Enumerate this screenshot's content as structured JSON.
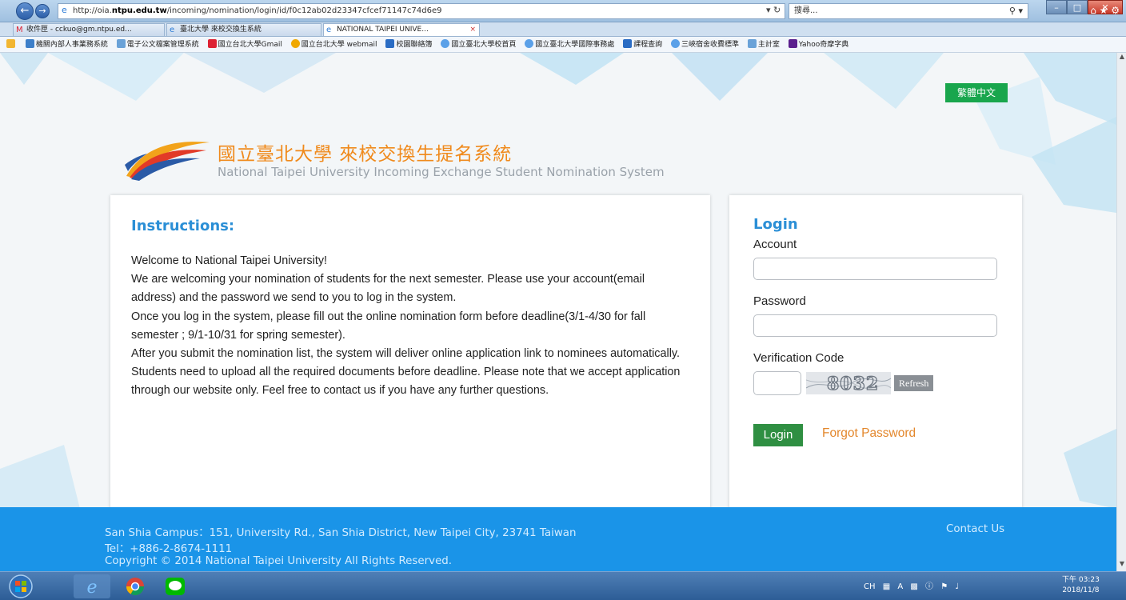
{
  "browser": {
    "address_prefix": "http://oia.",
    "address_host": "ntpu.edu.tw",
    "address_path": "/incoming/nomination/login/id/f0c12ab02d23347cfcef71147c74d6e9",
    "search_placeholder": "搜尋...",
    "tabs": [
      {
        "label": "收件匣 - cckuo@gm.ntpu.ed..."
      },
      {
        "label": "臺北大學 來校交換生系統"
      },
      {
        "label": "NATIONAL TAIPEI UNIVE...",
        "active": true
      }
    ],
    "favorites": [
      "機關內部人事業務系統",
      "電子公文檔案管理系統",
      "國立台北大學Gmail",
      "國立台北大學 webmail",
      "校園聯絡簿",
      "國立臺北大學校首頁",
      "國立臺北大學國際事務處",
      "課程查詢",
      "三峽宿舍收費標準",
      "主計室",
      "Yahoo奇摩字典"
    ]
  },
  "page": {
    "language_button": "繁體中文",
    "title_zh": "國立臺北大學 來校交換生提名系統",
    "title_en": "National Taipei University Incoming Exchange Student Nomination System",
    "instructions": {
      "heading": "Instructions:",
      "paragraphs": [
        "Welcome to National Taipei University!",
        "We are welcoming your nomination of students for the next semester. Please use your account(email address) and the password we send to you to log in the system.",
        "Once you log in the system, please fill out the online nomination form before deadline(3/1-4/30 for fall semester ; 9/1-10/31 for spring semester).",
        "After you submit the nomination list, the system will deliver online application link to nominees automatically. Students need to upload all the required documents before deadline. Please note that we accept application through our website only. Feel free to contact us if you have any further questions."
      ]
    },
    "login": {
      "heading": "Login",
      "account_label": "Account",
      "password_label": "Password",
      "verification_label": "Verification Code",
      "captcha_text": "8032",
      "refresh_label": "Refresh",
      "login_button": "Login",
      "forgot_link": "Forgot Password"
    },
    "footer": {
      "address": "San Shia Campus：151, University Rd., San Shia District, New Taipei City, 23741 Taiwan",
      "tel": "Tel：+886-2-8674-1111",
      "copyright": "Copyright © 2014 National Taipei University All Rights Reserved.",
      "contact": "Contact Us"
    }
  },
  "taskbar": {
    "tray_lang": "CH",
    "clock_ampm": "下午 03:23",
    "clock_date": "2018/11/8"
  },
  "colors": {
    "accent_blue": "#2b8fd6",
    "title_orange": "#f08a1c",
    "login_green": "#2f8f42",
    "footer_blue": "#1a94e8",
    "lang_green": "#19a64d"
  }
}
